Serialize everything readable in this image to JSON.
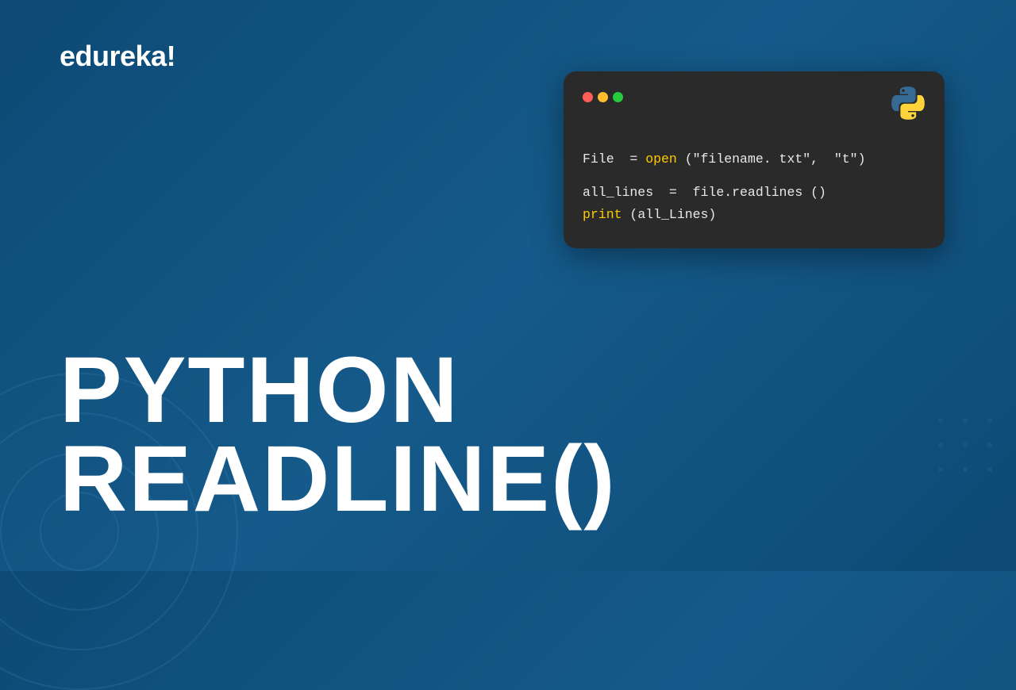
{
  "logo": "edureka!",
  "title": {
    "line1": "PYTHON",
    "line2": "READLINE()"
  },
  "code": {
    "line1_pre": "File  = ",
    "line1_kw": "open",
    "line1_post": " (\"filename. txt\",  \"t\")",
    "line2": "all_lines  =  file.readlines ()",
    "line3_kw": "print",
    "line3_post": " (all_Lines)"
  },
  "colors": {
    "background": "#0d4a75",
    "card": "#2a2a2a",
    "keyword": "#ffcc00",
    "text_white": "#ffffff",
    "traffic_red": "#ff5f56",
    "traffic_yellow": "#ffbd2e",
    "traffic_green": "#27c93f",
    "python_blue": "#366994",
    "python_yellow": "#ffd43b"
  },
  "icons": {
    "traffic_red": "traffic-light-red",
    "traffic_yellow": "traffic-light-yellow",
    "traffic_green": "traffic-light-green",
    "python": "python-logo"
  }
}
